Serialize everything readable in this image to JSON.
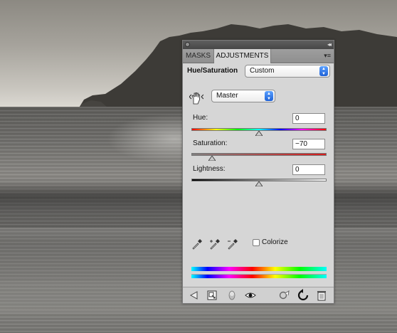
{
  "panel": {
    "tabs": [
      {
        "label": "MASKS",
        "active": false
      },
      {
        "label": "ADJUSTMENTS",
        "active": true
      }
    ],
    "header_title": "Hue/Saturation",
    "preset": "Custom",
    "channel": "Master",
    "hue": {
      "label": "Hue:",
      "value": "0",
      "position": 0.5
    },
    "saturation": {
      "label": "Saturation:",
      "value": "−70",
      "position": 0.15
    },
    "lightness": {
      "label": "Lightness:",
      "value": "0",
      "position": 0.5
    },
    "colorize": {
      "label": "Colorize",
      "checked": false
    },
    "icons": {
      "titlebar": [
        "close-icon",
        "collapse-icon"
      ],
      "tabbar": [
        "panel-menu-icon"
      ],
      "tools": [
        "hand-adjust-icon",
        "eyedropper-icon",
        "eyedropper-plus-icon",
        "eyedropper-minus-icon"
      ],
      "footer": [
        "back-arrow-icon",
        "clip-to-layer-icon",
        "mask-icon",
        "visibility-eye-icon",
        "previous-state-icon",
        "reset-icon",
        "trash-icon"
      ]
    },
    "colors": {
      "accent_select": "#2f7cf0",
      "panel_bg": "#d6d6d6"
    }
  }
}
